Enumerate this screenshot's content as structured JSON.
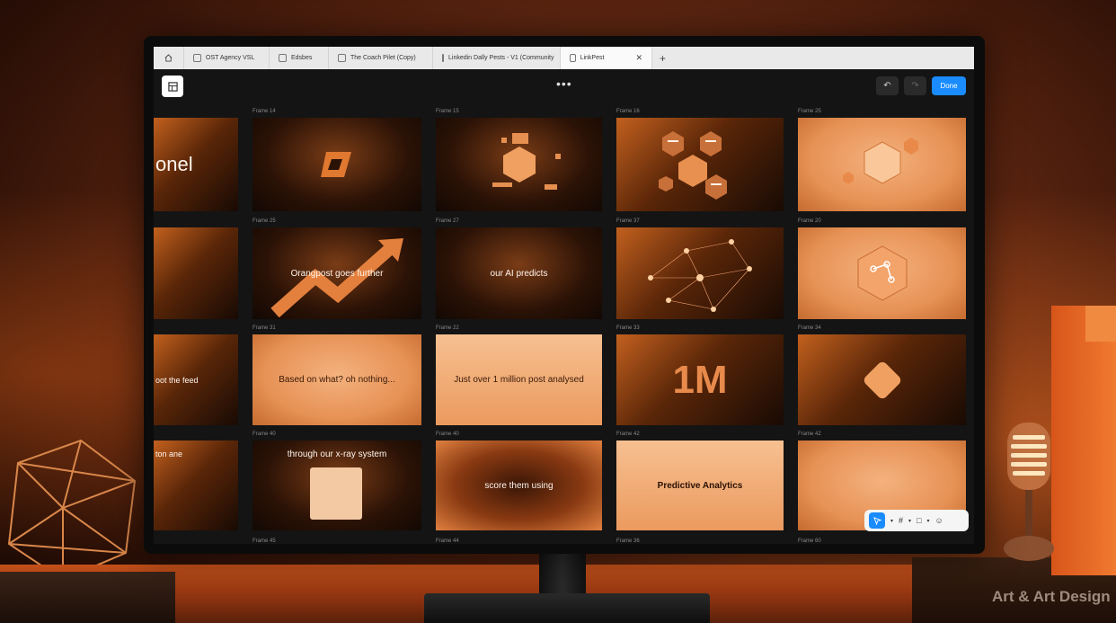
{
  "tabs": [
    {
      "label": "OST Agency VSL",
      "active": false
    },
    {
      "label": "Edsbes",
      "active": false
    },
    {
      "label": "The Coach Pilet (Copy)",
      "active": false
    },
    {
      "label": "Linkedin Dally Pests - V1 (Community",
      "active": false
    },
    {
      "label": "LinkPest",
      "active": true
    }
  ],
  "toolbar": {
    "more": "•••",
    "done_label": "Done",
    "undo_icon": "↶",
    "redo_icon": "↷"
  },
  "frames": [
    {
      "label": "",
      "text": "onel"
    },
    {
      "label": "Frame 14",
      "text": ""
    },
    {
      "label": "Frame 15",
      "text": ""
    },
    {
      "label": "Frame 16",
      "text": ""
    },
    {
      "label": "Frame 25",
      "text": ""
    },
    {
      "label": "",
      "text": ""
    },
    {
      "label": "Frame 25",
      "text": "Orangpost goes further"
    },
    {
      "label": "Frame 27",
      "text": "our AI predicts"
    },
    {
      "label": "Frame 37",
      "text": ""
    },
    {
      "label": "Frame 20",
      "text": ""
    },
    {
      "label": "",
      "text": "oot the feed"
    },
    {
      "label": "Frame 31",
      "text": "Based on what? oh nothing..."
    },
    {
      "label": "Frame 22",
      "text": "Just over 1 million post analysed"
    },
    {
      "label": "Frame 33",
      "text": "1M"
    },
    {
      "label": "Frame 34",
      "text": ""
    },
    {
      "label": "",
      "text": "ton ane"
    },
    {
      "label": "Frame 40",
      "text": "through our x-ray system"
    },
    {
      "label": "Frame 40",
      "text": "score them using"
    },
    {
      "label": "Frame 42",
      "text": "Predictive Analytics"
    },
    {
      "label": "Frame 42",
      "text": ""
    }
  ],
  "bottom_labels": [
    "Frame 45",
    "Frame 44",
    "Frame 36",
    "Frame 60"
  ],
  "watermark": "Art & Art Design",
  "colors": {
    "accent": "#1a8cff",
    "orange": "#e88a4c"
  }
}
